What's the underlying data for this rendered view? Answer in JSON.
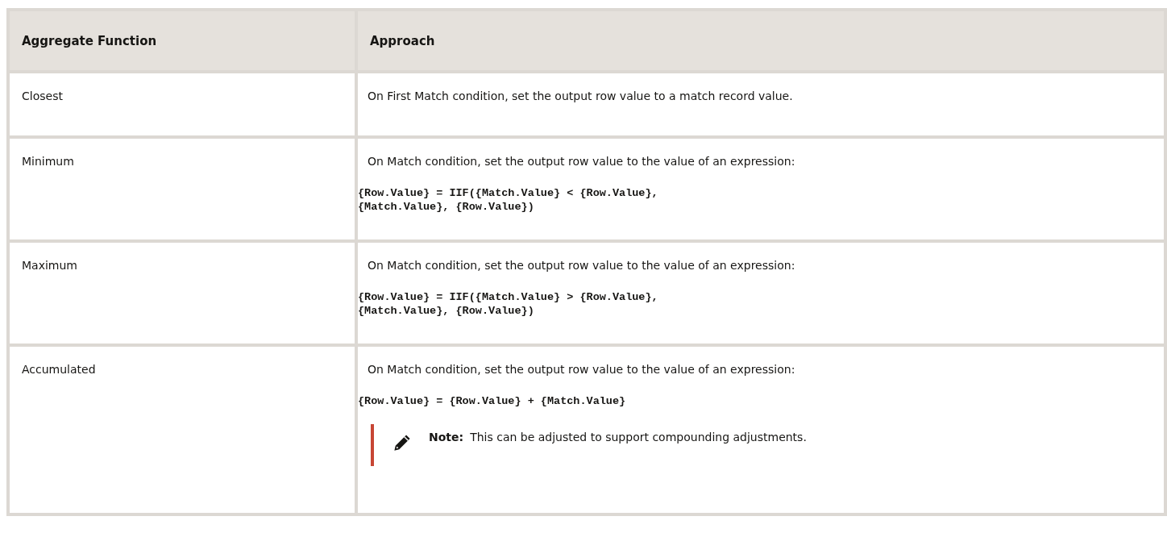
{
  "table": {
    "columns": [
      "Aggregate Function",
      "Approach"
    ],
    "rows": [
      {
        "function": "Closest",
        "approach": "On First Match condition, set the output row value to a match record value."
      },
      {
        "function": "Minimum",
        "approach": "On Match condition, set the output row value to the value of an expression:",
        "code": [
          "{Row.Value} = IIF({Match.Value} < {Row.Value},",
          "{Match.Value}, {Row.Value})"
        ]
      },
      {
        "function": "Maximum",
        "approach": "On Match condition, set the output row value to the value of an expression:",
        "code": [
          "{Row.Value} = IIF({Match.Value} > {Row.Value},",
          "{Match.Value}, {Row.Value})"
        ]
      },
      {
        "function": "Accumulated",
        "approach": "On Match condition, set the output row value to the value of an expression:",
        "code": [
          "{Row.Value} = {Row.Value} + {Match.Value}"
        ],
        "note": {
          "label": "Note:",
          "text": "This can be adjusted to support compounding adjustments."
        }
      }
    ]
  }
}
